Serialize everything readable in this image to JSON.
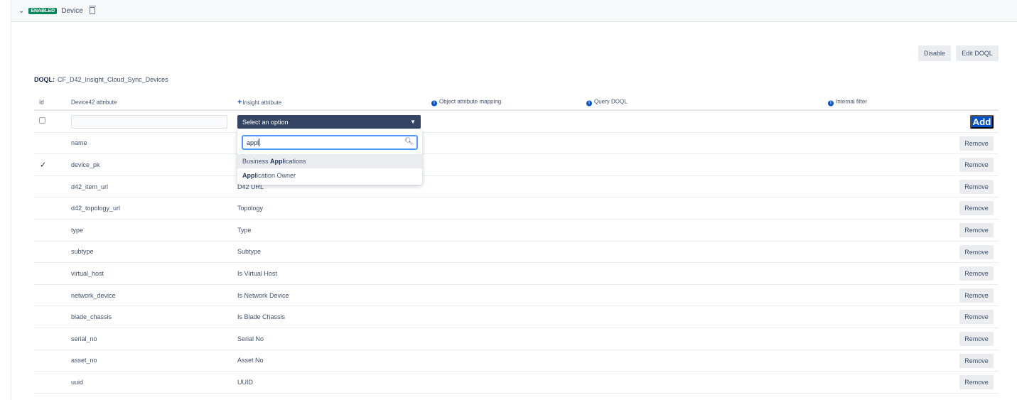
{
  "header": {
    "status_badge": "ENABLED",
    "title": "Device"
  },
  "actions": {
    "disable": "Disable",
    "edit_doql": "Edit DOQL"
  },
  "doql": {
    "label": "DOQL:",
    "value": "CF_D42_Insight_Cloud_Sync_Devices"
  },
  "table": {
    "columns": {
      "id": "Id",
      "device42": "Device42 attribute",
      "insight": "Insight attribute",
      "mapping": "Object attribute mapping",
      "query": "Query DOQL",
      "filter": "Internal filter"
    },
    "new_row": {
      "device42_value": "",
      "select_placeholder": "Select an option",
      "add": "Add"
    },
    "remove_label": "Remove",
    "rows": [
      {
        "device42": "name",
        "insight": "",
        "id": false
      },
      {
        "device42": "device_pk",
        "insight": "",
        "id": true
      },
      {
        "device42": "d42_item_url",
        "insight": "D42 URL",
        "id": false
      },
      {
        "device42": "d42_topology_url",
        "insight": "Topology",
        "id": false
      },
      {
        "device42": "type",
        "insight": "Type",
        "id": false
      },
      {
        "device42": "subtype",
        "insight": "Subtype",
        "id": false
      },
      {
        "device42": "virtual_host",
        "insight": "Is Virtual Host",
        "id": false
      },
      {
        "device42": "network_device",
        "insight": "Is Network Device",
        "id": false
      },
      {
        "device42": "blade_chassis",
        "insight": "Is Blade Chassis",
        "id": false
      },
      {
        "device42": "serial_no",
        "insight": "Serial No",
        "id": false
      },
      {
        "device42": "asset_no",
        "insight": "Asset No",
        "id": false
      },
      {
        "device42": "uuid",
        "insight": "UUID",
        "id": false
      }
    ]
  },
  "dropdown": {
    "search_value": "appl",
    "options": [
      {
        "pre": "Business ",
        "match": "Appl",
        "post": "ications",
        "highlighted": true
      },
      {
        "pre": "",
        "match": "Appl",
        "post": "ication Owner",
        "highlighted": false
      }
    ]
  },
  "colors": {
    "enabled": "#00875a",
    "primary": "#0052cc",
    "select_bg": "#344563"
  }
}
